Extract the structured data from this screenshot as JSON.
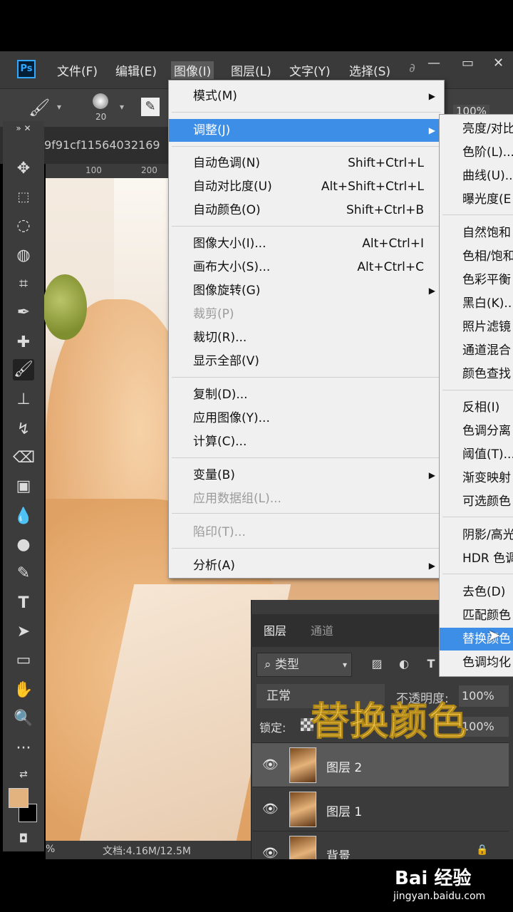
{
  "menubar": {
    "logo": "Ps",
    "items": [
      "文件(F)",
      "编辑(E)",
      "图像(I)",
      "图层(L)",
      "文字(Y)",
      "选择(S)",
      "∂"
    ],
    "window_controls": [
      "—",
      "▭",
      "✕"
    ]
  },
  "options": {
    "brush_size": "20",
    "zoom": "100%"
  },
  "document": {
    "tab_title": "9f91cf11564032169",
    "ruler_ticks": [
      "100",
      "200"
    ]
  },
  "status": {
    "zoom": "%",
    "doc_size": "文档:4.16M/12.5M"
  },
  "image_menu": {
    "items": [
      {
        "label": "模式(M)",
        "shortcut": "",
        "submenu": true,
        "disabled": false
      },
      {
        "label": "调整(J)",
        "shortcut": "",
        "submenu": true,
        "disabled": false,
        "highlight": true
      },
      {
        "label": "自动色调(N)",
        "shortcut": "Shift+Ctrl+L"
      },
      {
        "label": "自动对比度(U)",
        "shortcut": "Alt+Shift+Ctrl+L"
      },
      {
        "label": "自动颜色(O)",
        "shortcut": "Shift+Ctrl+B"
      },
      {
        "label": "图像大小(I)...",
        "shortcut": "Alt+Ctrl+I"
      },
      {
        "label": "画布大小(S)...",
        "shortcut": "Alt+Ctrl+C"
      },
      {
        "label": "图像旋转(G)",
        "shortcut": ""
      },
      {
        "label": "裁剪(P)",
        "shortcut": ""
      },
      {
        "label": "裁切(R)...",
        "shortcut": ""
      },
      {
        "label": "显示全部(V)",
        "shortcut": ""
      },
      {
        "label": "复制(D)...",
        "shortcut": ""
      },
      {
        "label": "应用图像(Y)...",
        "shortcut": ""
      },
      {
        "label": "计算(C)...",
        "shortcut": ""
      },
      {
        "label": "变量(B)",
        "shortcut": ""
      },
      {
        "label": "应用数据组(L)...",
        "shortcut": ""
      },
      {
        "label": "陷印(T)...",
        "shortcut": ""
      },
      {
        "label": "分析(A)",
        "shortcut": ""
      }
    ]
  },
  "adjust_submenu": {
    "items": [
      "亮度/对比",
      "色阶(L)...",
      "曲线(U)...",
      "曝光度(E",
      "自然饱和",
      "色相/饱和",
      "色彩平衡",
      "黑白(K)...",
      "照片滤镜",
      "通道混合",
      "颜色查找",
      "反相(I)",
      "色调分离",
      "阈值(T)...",
      "渐变映射",
      "可选颜色",
      "阴影/高光",
      "HDR 色调",
      "去色(D)",
      "匹配颜色",
      "替换颜色",
      "色调均化"
    ]
  },
  "layers_panel": {
    "tabs": [
      "图层",
      "通道"
    ],
    "filter": "类型",
    "blend_mode": "正常",
    "opacity_label": "不透明度:",
    "opacity": "100%",
    "lock_label": "锁定:",
    "fill": "100%",
    "layers": [
      "图层 2",
      "图层 1",
      "背景"
    ]
  },
  "overlay_caption": "替换颜色",
  "watermark": {
    "brand": "Bai 经验",
    "url": "jingyan.baidu.com"
  }
}
